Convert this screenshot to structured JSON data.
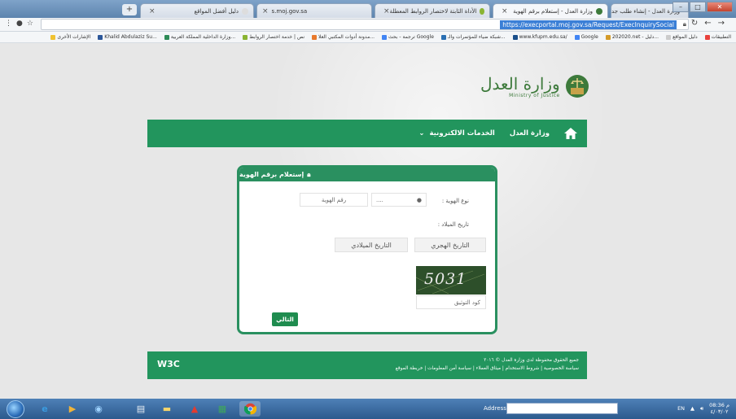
{
  "browser": {
    "tabs": [
      {
        "title": "وزارة العدل - إنشاء طلب جديد",
        "active": false
      },
      {
        "title": "وزارة العدل - إستعلام برقم الهوية",
        "active": true
      },
      {
        "title": "الأداة الثابتة لاختصار الروابط المعطلة",
        "active": false
      },
      {
        "title": "s.moj.gov.sa",
        "active": false
      },
      {
        "title": "دليل أفضل المواقع",
        "active": false
      }
    ],
    "new_tab_label": "+",
    "url": "https://execportal.moj.gov.sa/Request/ExecInquirySocial",
    "window_controls": [
      "–",
      "□",
      "✕"
    ],
    "bookmarks": [
      {
        "label": "التطبيقات",
        "color": "#e9423d"
      },
      {
        "label": "دليل المواقع",
        "color": "#cccccc"
      },
      {
        "label": "202020.net - دليل...",
        "color": "#d49b2a"
      },
      {
        "label": "Google",
        "color": "#4285f4"
      },
      {
        "label": "www.kfupm.edu.sa/",
        "color": "#1a4f8b"
      },
      {
        "label": "شبكة ضياء للمؤتمرات والـ...",
        "color": "#2a6fb3"
      },
      {
        "label": "ترجمة - بحث Google",
        "color": "#4285f4"
      },
      {
        "label": "مدونة أدوات المكتبي العلا...",
        "color": "#e8792c"
      },
      {
        "label": "نص | خدمة اختصار الروابط",
        "color": "#8ab432"
      },
      {
        "label": "وزارة الداخلية المملكة العربية...",
        "color": "#2e8b57"
      },
      {
        "label": "Khalid Abdulaziz Su...",
        "color": "#2b579a"
      },
      {
        "label": "الإشارات الأخرى",
        "color": "#f0c230"
      }
    ]
  },
  "site": {
    "logo_ar": "وزارة العدل",
    "logo_en": "Ministry of Justice",
    "nav": {
      "ministry": "وزارة العدل",
      "eservices": "الخدمات الالكترونية",
      "dropdown_arrow": "⌄"
    },
    "card": {
      "title": "إستعلام برقم الهوية",
      "id_type_label": "نوع الهوية :",
      "id_type_value": "رقم الهوية",
      "dropdown_dots": "....",
      "birthdate_label": "تاريخ الميلاد :",
      "hijri_button": "التاريخ الهجري",
      "gregorian_button": "التاريخ الميلادي",
      "captcha_value": "5031",
      "captcha_label": "كود التوثيق",
      "next_button": "التالي"
    },
    "footer": {
      "copyright": "جميع الحقوق محفوظة لدى وزارة العدل © ٢٠١٦",
      "links": "سياسة الخصوصية | شروط الاستخدام | ميثاق العملاء | سياسة أمن المعلومات | خريطة الموقع",
      "w3c": "W3C"
    }
  },
  "taskbar": {
    "address_label": "Address",
    "language": "EN",
    "time": "08:36 م",
    "date": "٤/٠٣/٠٢"
  }
}
